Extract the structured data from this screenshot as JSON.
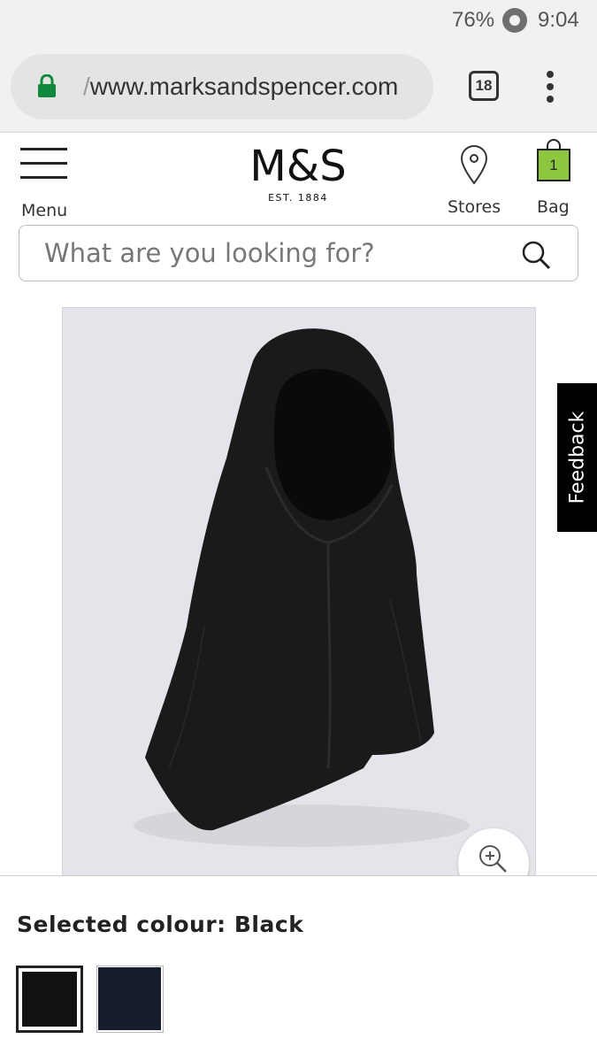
{
  "status_bar": {
    "battery": "76%",
    "time": "9:04"
  },
  "browser": {
    "url_prefix": "/",
    "url": "www.marksandspencer.com",
    "tab_count": "18",
    "colors": {
      "lock": "#0f8a3c"
    }
  },
  "header": {
    "menu_label": "Menu",
    "brand": "M&S",
    "brand_tagline": "EST. 1884",
    "stores_label": "Stores",
    "bag_label": "Bag",
    "bag_count": "1",
    "colors": {
      "bag": "#8dc63f"
    }
  },
  "search": {
    "placeholder": "What are you looking for?"
  },
  "product": {
    "image_icon": "zoom-in-icon",
    "selected_colour_text": "Selected colour: Black",
    "swatches": [
      {
        "name": "Black",
        "color": "#111111",
        "selected": true
      },
      {
        "name": "Navy",
        "color": "#171c2e",
        "selected": false
      }
    ]
  },
  "feedback": {
    "label": "Feedback"
  }
}
